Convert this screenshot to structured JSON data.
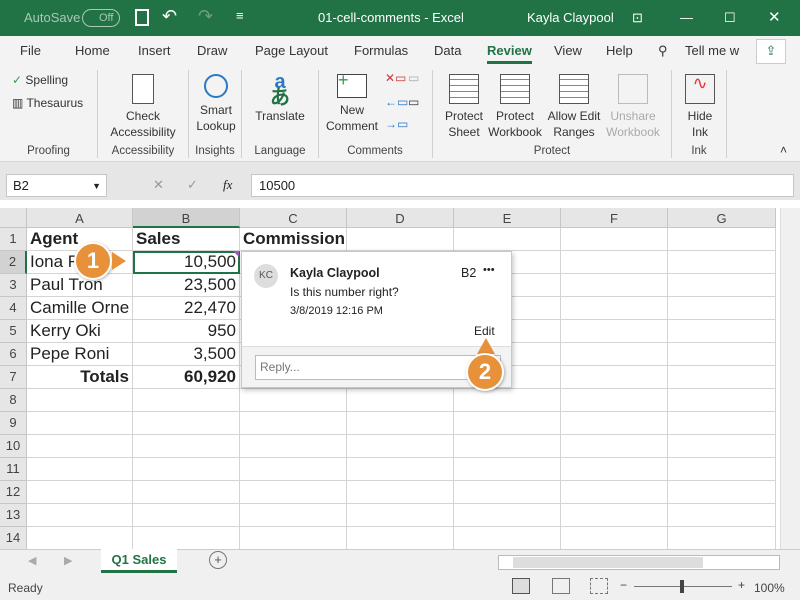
{
  "titlebar": {
    "autosave": "AutoSave",
    "autosave_state": "Off",
    "title": "01-cell-comments  -  Excel",
    "user": "Kayla Claypool"
  },
  "tabs": [
    "File",
    "Home",
    "Insert",
    "Draw",
    "Page Layout",
    "Formulas",
    "Data",
    "Review",
    "View",
    "Help"
  ],
  "active_tab": "Review",
  "tell_me": "Tell me w",
  "ribbon": {
    "spelling": "Spelling",
    "thesaurus": "Thesaurus",
    "proofing": "Proofing",
    "check_accessibility": [
      "Check",
      "Accessibility"
    ],
    "accessibility": "Accessibility",
    "smart_lookup": [
      "Smart",
      "Lookup"
    ],
    "insights": "Insights",
    "translate": "Translate",
    "language": "Language",
    "new_comment": [
      "New",
      "Comment"
    ],
    "comments": "Comments",
    "protect_sheet": [
      "Protect",
      "Sheet"
    ],
    "protect_workbook": [
      "Protect",
      "Workbook"
    ],
    "allow_edit_ranges": [
      "Allow Edit",
      "Ranges"
    ],
    "unshare_workbook": [
      "Unshare",
      "Workbook"
    ],
    "protect": "Protect",
    "hide_ink": [
      "Hide",
      "Ink"
    ],
    "ink": "Ink"
  },
  "formula_bar": {
    "name_box": "B2",
    "fx": "fx",
    "value": "10500"
  },
  "columns": [
    "A",
    "B",
    "C",
    "D",
    "E",
    "F",
    "G"
  ],
  "rows": [
    "1",
    "2",
    "3",
    "4",
    "5",
    "6",
    "7",
    "8",
    "9",
    "10",
    "11",
    "12",
    "13",
    "14"
  ],
  "cells": [
    [
      "Agent",
      "Sales",
      "Commission"
    ],
    [
      "Iona Ford",
      "10,500",
      ""
    ],
    [
      "Paul Tron",
      "23,500",
      ""
    ],
    [
      "Camille Orne",
      "22,470",
      ""
    ],
    [
      "Kerry Oki",
      "950",
      ""
    ],
    [
      "Pepe Roni",
      "3,500",
      ""
    ],
    [
      "Totals",
      "60,920",
      ""
    ]
  ],
  "comment": {
    "initials": "KC",
    "author": "Kayla Claypool",
    "cell": "B2",
    "more": "•••",
    "text": "Is this number right?",
    "timestamp": "3/8/2019 12:16 PM",
    "edit": "Edit",
    "reply_placeholder": "Reply..."
  },
  "callouts": [
    "1",
    "2"
  ],
  "sheet_tab": "Q1 Sales",
  "status": {
    "ready": "Ready",
    "zoom": "100%"
  },
  "colors": {
    "excel_green": "#217346",
    "callout": "#e8913b"
  }
}
